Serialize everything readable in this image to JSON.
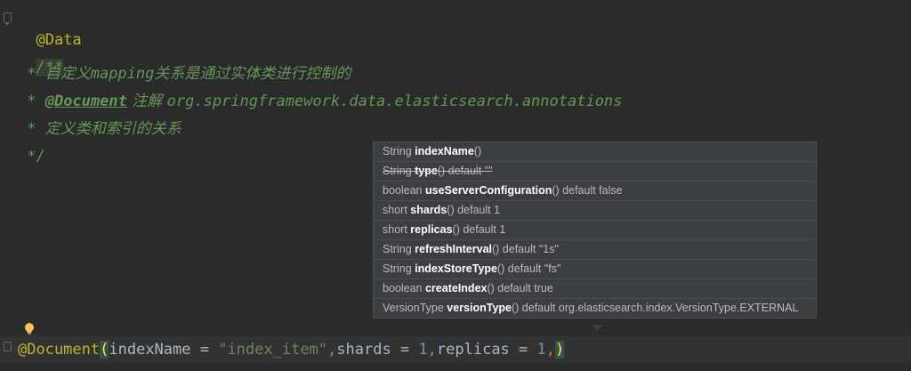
{
  "editor": {
    "line1": {
      "annotation": "@Data"
    },
    "line2": {
      "doc_open": "/**"
    },
    "line3": {
      "star": " * ",
      "text_cn1": "自定义",
      "text_mapping": "mapping",
      "text_cn2": "关系是通过实体类进行控制的"
    },
    "line4": {
      "star": " * ",
      "tag": "@Document",
      "text_cn": " 注解 ",
      "text_pkg": "org.springframework.data.elasticsearch.annotations"
    },
    "line5": {
      "star": " * ",
      "text_cn": "定义类和索引的关系"
    },
    "line6": {
      "doc_close": " */"
    },
    "line7": {
      "annotation": "@Document",
      "open_paren": "(",
      "param1": "indexName = ",
      "value1": "\"index_item\"",
      "comma1": ",",
      "param2": "shards = ",
      "value2": "1",
      "comma2": ",",
      "param3": "replicas = ",
      "value3": "1",
      "comma3": ",",
      "close_paren": ")"
    }
  },
  "popup": {
    "rows": [
      {
        "type": "String",
        "name": "indexName",
        "rest": "()",
        "deprecated": false
      },
      {
        "type": "String",
        "name": "type",
        "rest": "() default \"\"",
        "deprecated": true
      },
      {
        "type": "boolean",
        "name": "useServerConfiguration",
        "rest": "() default false",
        "deprecated": false
      },
      {
        "type": "short",
        "name": "shards",
        "rest": "() default 1",
        "deprecated": false
      },
      {
        "type": "short",
        "name": "replicas",
        "rest": "() default 1",
        "deprecated": false
      },
      {
        "type": "String",
        "name": "refreshInterval",
        "rest": "() default \"1s\"",
        "deprecated": false
      },
      {
        "type": "String",
        "name": "indexStoreType",
        "rest": "() default \"fs\"",
        "deprecated": false
      },
      {
        "type": "boolean",
        "name": "createIndex",
        "rest": "() default true",
        "deprecated": false
      },
      {
        "type": "VersionType",
        "name": "versionType",
        "rest": "() default org.elasticsearch.index.VersionType.EXTERNAL",
        "deprecated": false
      }
    ]
  },
  "icons": {
    "fold": "fold-marker-icon",
    "bulb": "lightbulb-icon"
  },
  "colors": {
    "background": "#2b2b2b",
    "annotation": "#bbb529",
    "comment": "#629755",
    "string": "#6a8759",
    "number": "#6897bb",
    "keyword": "#cc7832",
    "popup_bg": "#3c3f41"
  }
}
